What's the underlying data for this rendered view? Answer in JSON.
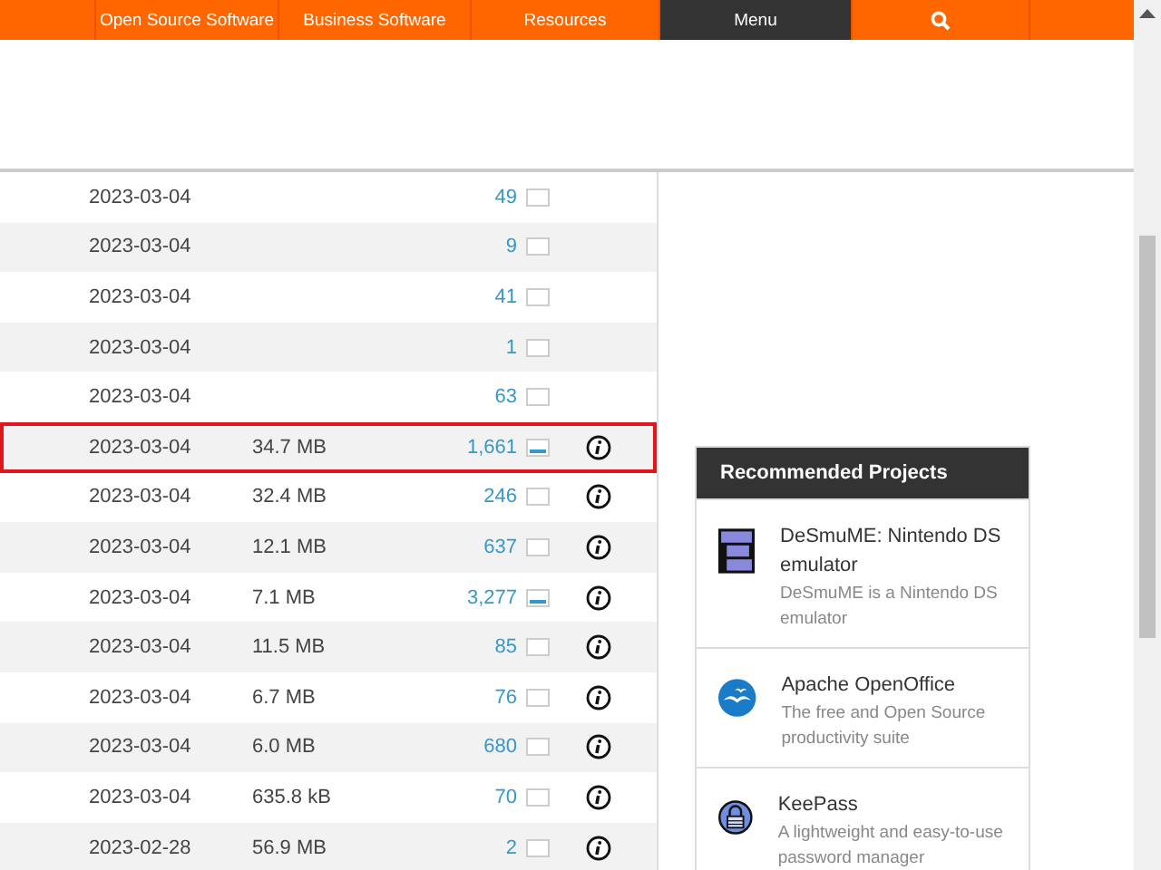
{
  "nav": [
    {
      "label": "Open Source Software",
      "selected": false
    },
    {
      "label": "Business Software",
      "selected": false
    },
    {
      "label": "Resources",
      "selected": false
    },
    {
      "label": "Menu",
      "selected": true
    }
  ],
  "rows": [
    {
      "date": "2023-03-04",
      "downloads": "49",
      "graph_active": false,
      "info": false,
      "highlighted": false
    },
    {
      "date": "2023-03-04",
      "downloads": "9",
      "graph_active": false,
      "info": false,
      "highlighted": false
    },
    {
      "date": "2023-03-04",
      "downloads": "41",
      "graph_active": false,
      "info": false,
      "highlighted": false
    },
    {
      "date": "2023-03-04",
      "downloads": "1",
      "graph_active": false,
      "info": false,
      "highlighted": false
    },
    {
      "date": "2023-03-04",
      "downloads": "63",
      "graph_active": false,
      "info": false,
      "highlighted": false
    },
    {
      "date": "2023-03-04",
      "size": "34.7 MB",
      "downloads": "1,661",
      "graph_active": true,
      "info": true,
      "highlighted": true
    },
    {
      "date": "2023-03-04",
      "size": "32.4 MB",
      "downloads": "246",
      "graph_active": false,
      "info": true,
      "highlighted": false
    },
    {
      "date": "2023-03-04",
      "size": "12.1 MB",
      "downloads": "637",
      "graph_active": false,
      "info": true,
      "highlighted": false
    },
    {
      "date": "2023-03-04",
      "size": "7.1 MB",
      "downloads": "3,277",
      "graph_active": true,
      "info": true,
      "highlighted": false
    },
    {
      "date": "2023-03-04",
      "size": "11.5 MB",
      "downloads": "85",
      "graph_active": false,
      "info": true,
      "highlighted": false
    },
    {
      "date": "2023-03-04",
      "size": "6.7 MB",
      "downloads": "76",
      "graph_active": false,
      "info": true,
      "highlighted": false
    },
    {
      "date": "2023-03-04",
      "size": "6.0 MB",
      "downloads": "680",
      "graph_active": false,
      "info": true,
      "highlighted": false
    },
    {
      "date": "2023-03-04",
      "size": "635.8 kB",
      "downloads": "70",
      "graph_active": false,
      "info": true,
      "highlighted": false
    },
    {
      "date": "2023-02-28",
      "size": "56.9 MB",
      "downloads": "2",
      "graph_active": false,
      "info": true,
      "highlighted": false
    }
  ],
  "recommended": {
    "title": "Recommended Projects",
    "projects": [
      {
        "name": "DeSmuME: Nintendo DS emulator",
        "description": "DeSmuME is a Nintendo DS emulator"
      },
      {
        "name": "Apache OpenOffice",
        "description": "The free and Open Source productivity suite"
      },
      {
        "name": "KeePass",
        "description": "A lightweight and easy-to-use password manager"
      }
    ]
  }
}
